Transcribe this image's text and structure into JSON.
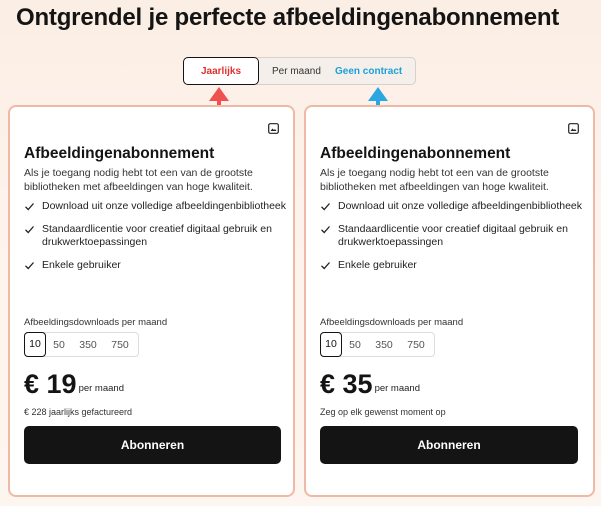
{
  "page": {
    "title": "Ontgrendel je perfecte afbeeldingenabonnement"
  },
  "billing_toggle": {
    "options": [
      "Jaarlijks",
      "Per maand",
      "Geen contract"
    ],
    "selected": "Jaarlijks",
    "colors": {
      "yearly": "#e03030",
      "no_contract": "#1ea0d8",
      "arrow_red": "#f05050",
      "arrow_blue": "#2aa6e0"
    }
  },
  "cards": [
    {
      "name": "Afbeeldingenabonnement",
      "icon": "image-icon",
      "description": "Als je toegang nodig hebt tot een van de grootste bibliotheken met afbeeldingen van hoge kwaliteit.",
      "features": [
        "Download uit onze volledige afbeeldingenbibliotheek",
        "Standaardlicentie voor creatief digitaal gebruik en drukwerktoepassingen",
        "Enkele gebruiker"
      ],
      "downloads_label": "Afbeeldingsdownloads per maand",
      "download_options": [
        "10",
        "50",
        "350",
        "750"
      ],
      "downloads_selected": "10",
      "price": "€ 19",
      "price_unit": "per maand",
      "billing_note": "€ 228 jaarlijks gefactureerd",
      "cta": "Abonneren"
    },
    {
      "name": "Afbeeldingenabonnement",
      "icon": "image-icon",
      "description": "Als je toegang nodig hebt tot een van de grootste bibliotheken met afbeeldingen van hoge kwaliteit.",
      "features": [
        "Download uit onze volledige afbeeldingenbibliotheek",
        "Standaardlicentie voor creatief digitaal gebruik en drukwerktoepassingen",
        "Enkele gebruiker"
      ],
      "downloads_label": "Afbeeldingsdownloads per maand",
      "download_options": [
        "10",
        "50",
        "350",
        "750"
      ],
      "downloads_selected": "10",
      "price": "€ 35",
      "price_unit": "per maand",
      "billing_note": "Zeg op elk gewenst moment op",
      "cta": "Abonneren"
    }
  ]
}
